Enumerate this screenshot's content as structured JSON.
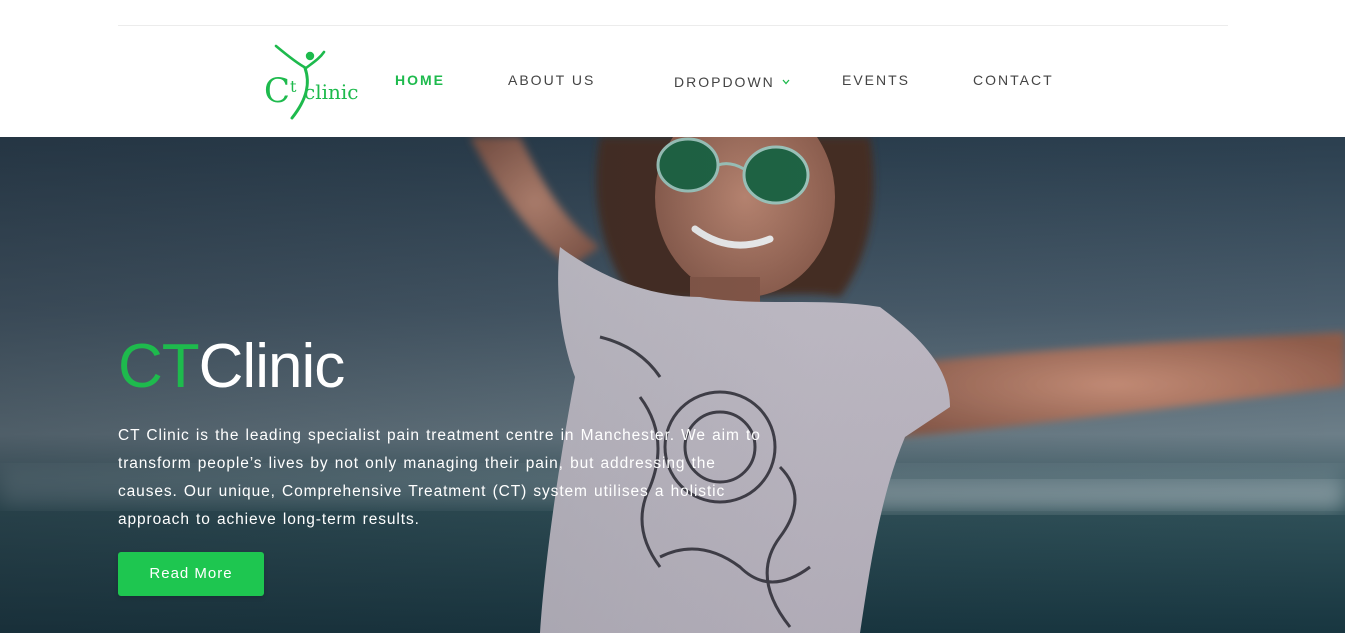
{
  "header": {
    "logo": {
      "letters_left": "C",
      "letters_mid": "t",
      "letters_right": "clinic"
    },
    "nav": {
      "home": "HOME",
      "about": "ABOUT US",
      "dropdown": "DROPDOWN",
      "events": "EVENTS",
      "contact": "CONTACT"
    },
    "active_item": "HOME"
  },
  "hero": {
    "title_green": "CT",
    "title_white": "Clinic",
    "description": "CT Clinic is the leading specialist pain treatment centre in Manchester. We aim to transform people’s lives by not only managing their pain, but addressing the causes. Our unique, Comprehensive Treatment (CT) system utilises a holistic approach to achieve long-term results.",
    "button_label": "Read More"
  },
  "colors": {
    "brand_green": "#1eba4d",
    "button_green": "#1ec650",
    "nav_text": "#444444",
    "hero_text": "#ffffff"
  },
  "icons": {
    "dropdown_chevron": "chevron-down-icon",
    "logo_figure": "person-figure-icon"
  }
}
